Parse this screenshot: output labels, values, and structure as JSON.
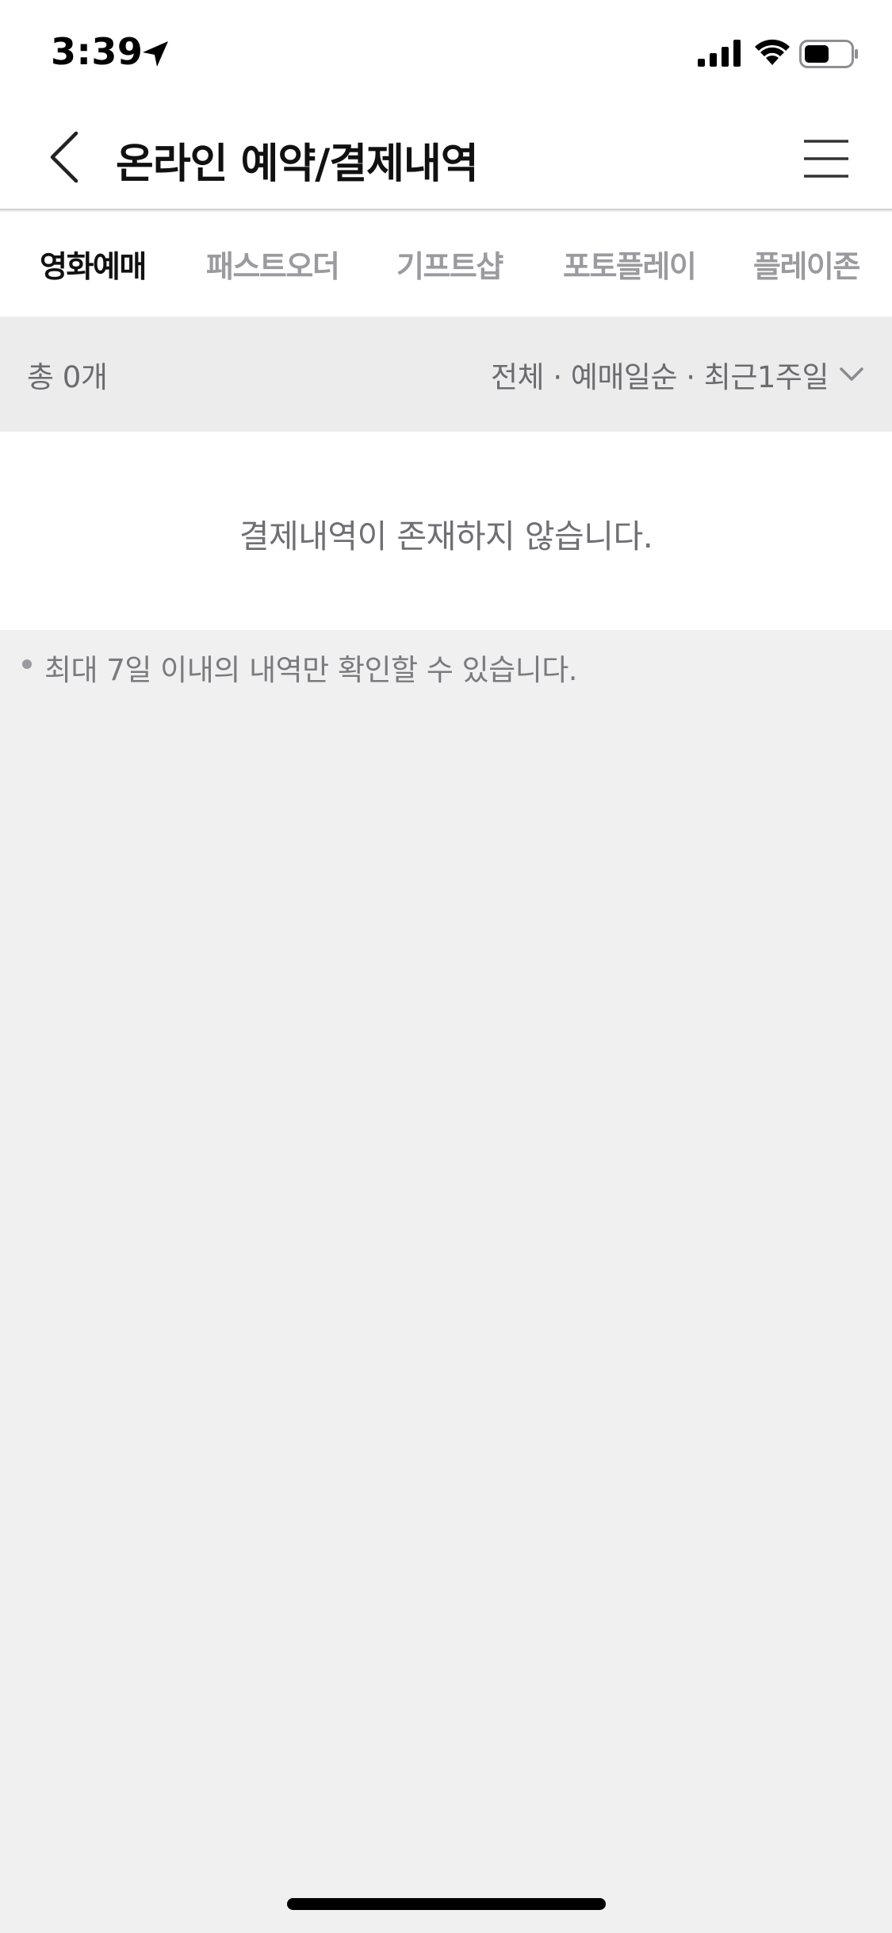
{
  "status_bar": {
    "time": "3:39",
    "icons": [
      "location-arrow-icon",
      "signal-icon",
      "wifi-icon",
      "battery-icon"
    ]
  },
  "header": {
    "title": "온라인 예약/결제내역",
    "back_icon": "chevron-left-icon",
    "menu_icon": "hamburger-menu-icon"
  },
  "tabs": [
    {
      "label": "영화예매",
      "active": true
    },
    {
      "label": "패스트오더",
      "active": false
    },
    {
      "label": "기프트샵",
      "active": false
    },
    {
      "label": "포토플레이",
      "active": false
    },
    {
      "label": "플레이존",
      "active": false
    }
  ],
  "summary": {
    "total": "총 0개",
    "filter": "전체 · 예매일순 · 최근1주일",
    "filter_icon": "chevron-down-icon"
  },
  "empty_message": "결제내역이 존재하지 않습니다.",
  "notice": "최대 7일 이내의 내역만 확인할 수 있습니다.",
  "colors": {
    "background": "#f0f0f0",
    "active_tab": "#111111",
    "inactive_tab": "#9a9a9f",
    "muted_text": "#6b6b70"
  }
}
